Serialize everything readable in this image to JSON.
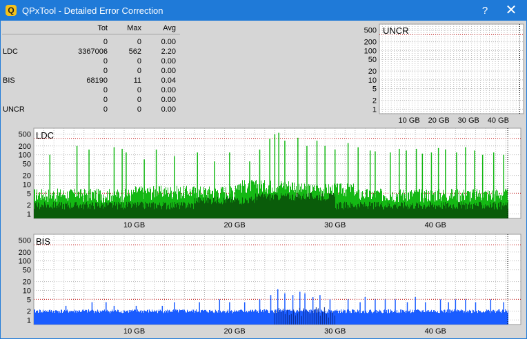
{
  "window": {
    "title": "QPxTool - Detailed Error Correction",
    "help_label": "?",
    "close_label": "✕"
  },
  "stats": {
    "headers": [
      "",
      "Tot",
      "Max",
      "Avg"
    ],
    "rows": [
      [
        "",
        "0",
        "0",
        "0.00"
      ],
      [
        "LDC",
        "3367006",
        "562",
        "2.20"
      ],
      [
        "",
        "0",
        "0",
        "0.00"
      ],
      [
        "",
        "0",
        "0",
        "0.00"
      ],
      [
        "BIS",
        "68190",
        "11",
        "0.04"
      ],
      [
        "",
        "0",
        "0",
        "0.00"
      ],
      [
        "",
        "0",
        "0",
        "0.00"
      ],
      [
        "UNCR",
        "0",
        "0",
        "0.00"
      ]
    ]
  },
  "colors": {
    "ldc_main": "#14b814",
    "ldc_dark": "#0a5c0a",
    "bis_main": "#1a5cff",
    "bis_dark": "#0a2a8a",
    "threshold": "#c00000",
    "grid": "#b8b8b8",
    "background": "#d6d6d6",
    "plot_background": "#ffffff"
  },
  "chart_data": [
    {
      "type": "bar",
      "title": "UNCR",
      "y_scale": "log",
      "ytick_labels": [
        "500",
        "200",
        "100",
        "50",
        "20",
        "10",
        "5",
        "2",
        "1"
      ],
      "ytick_values": [
        500,
        200,
        100,
        50,
        20,
        10,
        5,
        2,
        1
      ],
      "xtick_labels": [
        "10 GB",
        "20 GB",
        "30 GB",
        "40 GB"
      ],
      "xtick_values": [
        10,
        20,
        30,
        40
      ],
      "xlim": [
        0,
        48.5
      ],
      "threshold_lines": [
        350
      ],
      "values": [],
      "note_end_gb": 47.2
    },
    {
      "type": "bar",
      "title": "LDC",
      "y_scale": "log",
      "ytick_labels": [
        "500",
        "200",
        "100",
        "50",
        "20",
        "10",
        "5",
        "2",
        "1"
      ],
      "ytick_values": [
        500,
        200,
        100,
        50,
        20,
        10,
        5,
        2,
        1
      ],
      "xtick_labels": [
        "10 GB",
        "20 GB",
        "30 GB",
        "40 GB"
      ],
      "xtick_values": [
        10,
        20,
        30,
        40
      ],
      "xlim": [
        0,
        48.5
      ],
      "threshold_lines": [
        350,
        5
      ],
      "max": 562,
      "end_gb": 47.2,
      "baseline_segments": [
        {
          "from_gb": 0,
          "to_gb": 10,
          "level": 4
        },
        {
          "from_gb": 10,
          "to_gb": 20,
          "level": 5
        },
        {
          "from_gb": 20,
          "to_gb": 26,
          "level": 8
        },
        {
          "from_gb": 26,
          "to_gb": 32,
          "level": 6
        },
        {
          "from_gb": 32,
          "to_gb": 47.2,
          "level": 4
        }
      ],
      "dark_segments": [
        {
          "from_gb": 0,
          "to_gb": 16,
          "level": 2
        },
        {
          "from_gb": 16,
          "to_gb": 22,
          "level": 3
        },
        {
          "from_gb": 22,
          "to_gb": 30,
          "level": 4
        },
        {
          "from_gb": 30,
          "to_gb": 47.2,
          "level": 2
        }
      ],
      "spikes": [
        [
          1.6,
          100
        ],
        [
          4.3,
          200
        ],
        [
          5.5,
          150
        ],
        [
          8.0,
          180
        ],
        [
          8.8,
          160
        ],
        [
          9.2,
          120
        ],
        [
          11.0,
          70
        ],
        [
          12.2,
          150
        ],
        [
          14.0,
          90
        ],
        [
          16.3,
          120
        ],
        [
          18.0,
          60
        ],
        [
          19.5,
          120
        ],
        [
          21.5,
          60
        ],
        [
          22.5,
          150
        ],
        [
          23.5,
          350
        ],
        [
          24.0,
          500
        ],
        [
          24.4,
          560
        ],
        [
          25.0,
          300
        ],
        [
          26.3,
          380
        ],
        [
          27.2,
          200
        ],
        [
          28.2,
          300
        ],
        [
          29.0,
          200
        ],
        [
          30.0,
          150
        ],
        [
          31.3,
          250
        ],
        [
          32.3,
          180
        ],
        [
          33.5,
          140
        ],
        [
          34.0,
          130
        ],
        [
          35.5,
          120
        ],
        [
          36.4,
          160
        ],
        [
          37.1,
          140
        ],
        [
          38.1,
          160
        ],
        [
          38.7,
          110
        ],
        [
          39.6,
          120
        ],
        [
          40.3,
          170
        ],
        [
          41.0,
          150
        ],
        [
          42.1,
          120
        ],
        [
          43.0,
          180
        ],
        [
          43.9,
          140
        ],
        [
          44.7,
          100
        ],
        [
          45.8,
          120
        ],
        [
          46.8,
          100
        ]
      ]
    },
    {
      "type": "bar",
      "title": "BIS",
      "y_scale": "log",
      "ytick_labels": [
        "500",
        "200",
        "100",
        "50",
        "20",
        "10",
        "5",
        "2",
        "1"
      ],
      "ytick_values": [
        500,
        200,
        100,
        50,
        20,
        10,
        5,
        2,
        1
      ],
      "xtick_labels": [
        "10 GB",
        "20 GB",
        "30 GB",
        "40 GB"
      ],
      "xtick_values": [
        10,
        20,
        30,
        40
      ],
      "xlim": [
        0,
        48.5
      ],
      "threshold_lines": [
        350,
        5
      ],
      "max": 11,
      "end_gb": 47.2,
      "baseline_level": 2,
      "dark_region": [
        24.0,
        30.0
      ],
      "spikes": [
        [
          3.2,
          3
        ],
        [
          5.8,
          4
        ],
        [
          7.2,
          4
        ],
        [
          8.0,
          3
        ],
        [
          10.2,
          3
        ],
        [
          12.8,
          3
        ],
        [
          14.0,
          4
        ],
        [
          16.5,
          4
        ],
        [
          18.5,
          5
        ],
        [
          19.5,
          4
        ],
        [
          21.0,
          4
        ],
        [
          22.5,
          5
        ],
        [
          23.6,
          7
        ],
        [
          24.3,
          11
        ],
        [
          25.0,
          8
        ],
        [
          25.8,
          7
        ],
        [
          26.5,
          9
        ],
        [
          27.0,
          8
        ],
        [
          27.8,
          6
        ],
        [
          28.5,
          7
        ],
        [
          29.5,
          5
        ],
        [
          31.3,
          5
        ],
        [
          32.5,
          4
        ],
        [
          33.0,
          6
        ],
        [
          34.0,
          5
        ],
        [
          35.0,
          5
        ],
        [
          36.0,
          5
        ],
        [
          37.2,
          4
        ],
        [
          38.0,
          6
        ],
        [
          39.0,
          4
        ],
        [
          40.5,
          5
        ],
        [
          41.3,
          4
        ],
        [
          42.0,
          5
        ],
        [
          43.0,
          5
        ],
        [
          44.0,
          4
        ],
        [
          45.5,
          5
        ],
        [
          46.8,
          4
        ]
      ]
    }
  ]
}
